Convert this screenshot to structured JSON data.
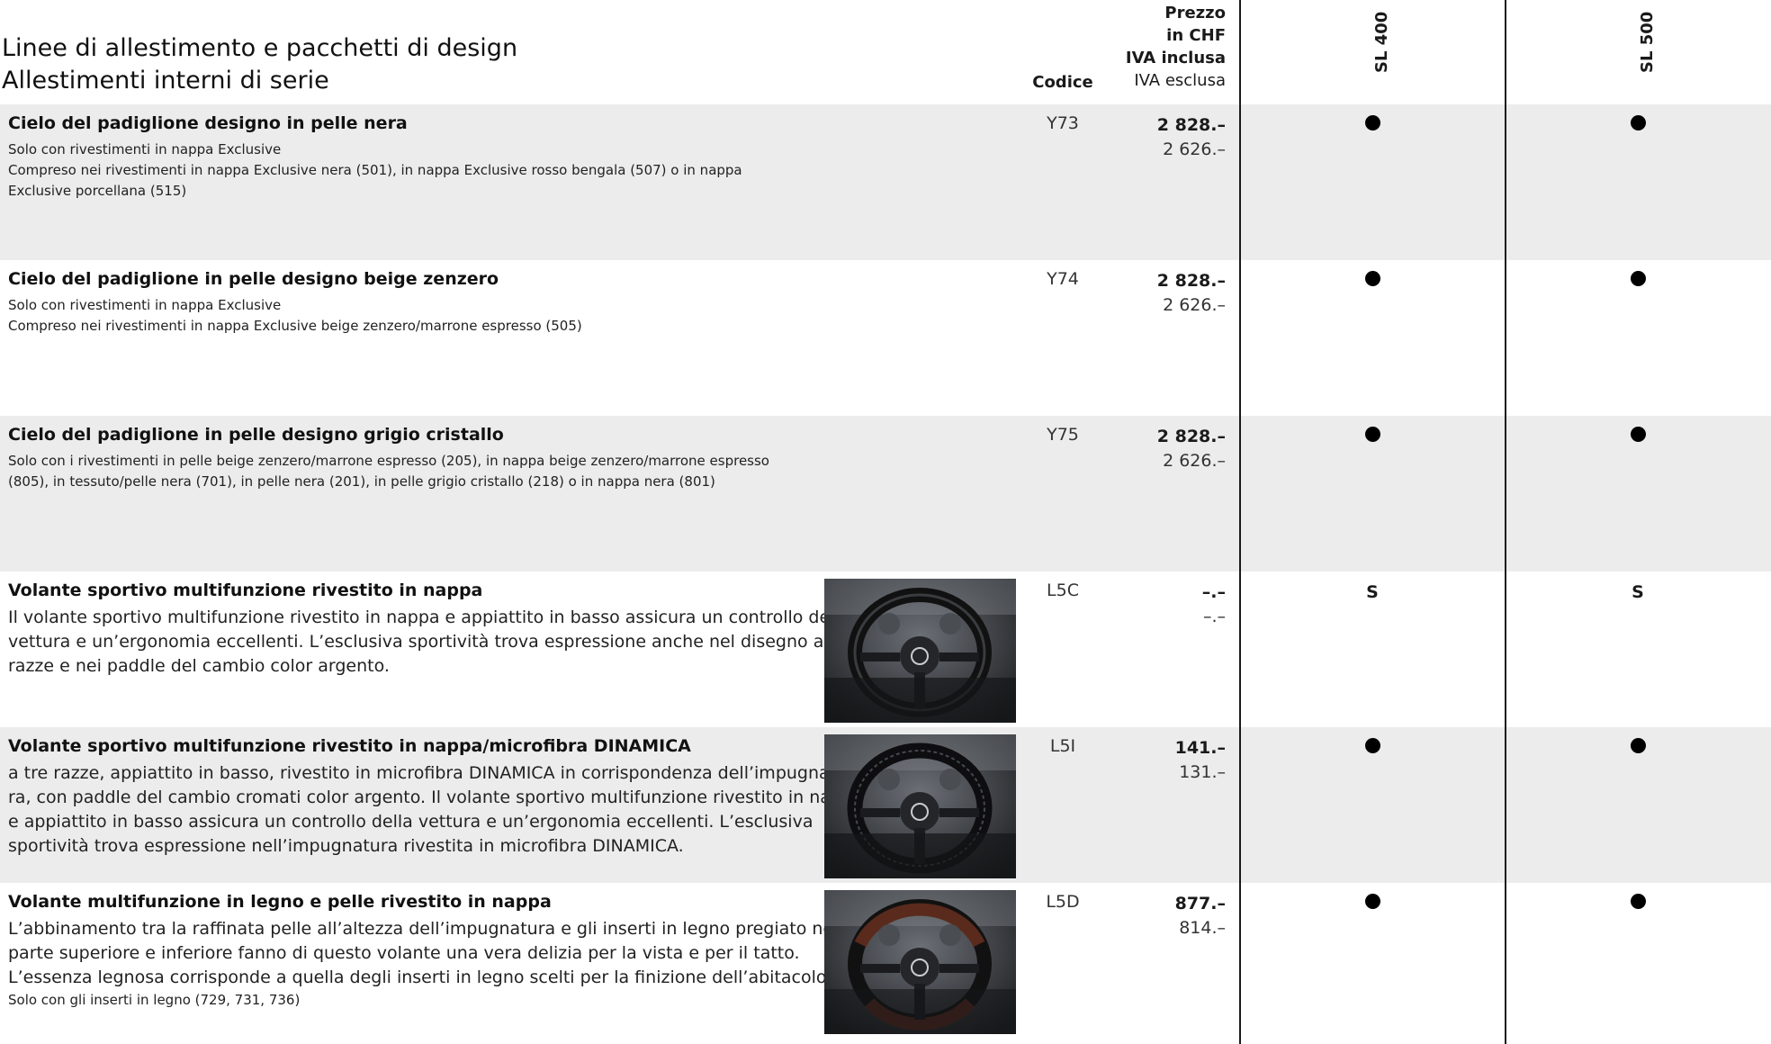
{
  "header": {
    "title_line1": "Linee di allestimento e pacchetti di design",
    "title_line2": "Allestimenti interni di serie",
    "code_label": "Codice",
    "price_line1": "Prezzo",
    "price_line2": "in CHF",
    "price_line3": "IVA inclusa",
    "price_line4": "IVA esclusa",
    "model1": "SL 400",
    "model2": "SL 500"
  },
  "rows": [
    {
      "title": "Cielo del padiglione designo in pelle nera",
      "notes": [
        "Solo con rivestimenti in nappa Exclusive",
        "Compreso nei rivestimenti in nappa Exclusive nera (501), in nappa Exclusive rosso bengala (507) o in nappa Exclusive porcellana (515)"
      ],
      "code": "Y73",
      "price_incl": "2 828.–",
      "price_excl": "2 626.–",
      "sl400": "●",
      "sl500": "●"
    },
    {
      "title": "Cielo del padiglione in pelle designo beige zenzero",
      "notes": [
        "Solo con rivestimenti in nappa Exclusive",
        "Compreso nei rivestimenti in nappa Exclusive beige zenzero/marrone espresso (505)"
      ],
      "code": "Y74",
      "price_incl": "2 828.–",
      "price_excl": "2 626.–",
      "sl400": "●",
      "sl500": "●"
    },
    {
      "title": "Cielo del padiglione in pelle designo grigio cristallo",
      "notes": [
        "Solo con i rivestimenti in pelle beige zenzero/marrone espresso (205), in nappa beige zenzero/marrone espresso (805), in tessuto/pelle nera (701), in pelle nera (201), in pelle grigio cristallo (218) o in nappa nera (801)"
      ],
      "code": "Y75",
      "price_incl": "2 828.–",
      "price_excl": "2 626.–",
      "sl400": "●",
      "sl500": "●"
    },
    {
      "title": "Volante sportivo multifunzione rivestito in nappa",
      "desc": [
        "Il volante sportivo multifunzione rivestito in nappa e appiattito in basso assicura un controllo della",
        "vettura e un’ergonomia eccellenti. L’esclusiva sportività trova espressione anche nel disegno a tre",
        "razze e nei paddle del cambio color argento."
      ],
      "code": "L5C",
      "price_incl": "–.–",
      "price_excl": "–.–",
      "sl400": "S",
      "sl500": "S"
    },
    {
      "title": "Volante sportivo multifunzione rivestito in nappa/microfibra DINAMICA",
      "desc": [
        "a tre razze, appiattito in basso, rivestito in microfibra DINAMICA in corrispondenza dell’impugnatu-",
        "ra, con paddle del cambio cromati color argento. Il volante sportivo multifunzione rivestito in nappa",
        "e appiattito in basso assicura un controllo della vettura e un’ergonomia eccellenti. L’esclusiva",
        "sportività trova espressione nell’impugnatura rivestita in microfibra DINAMICA."
      ],
      "code": "L5I",
      "price_incl": "141.–",
      "price_excl": "131.–",
      "sl400": "●",
      "sl500": "●"
    },
    {
      "title": "Volante multifunzione in legno e pelle rivestito in nappa",
      "desc": [
        "L’abbinamento tra la raffinata pelle all’altezza dell’impugnatura e gli inserti in legno pregiato nella",
        "parte superiore e inferiore fanno di questo volante una vera delizia per la vista e per il tatto.",
        "L’essenza legnosa corrisponde a quella degli inserti in legno scelti per la finizione dell’abitacolo."
      ],
      "note": "Solo con gli inserti in legno (729, 731, 736)",
      "code": "L5D",
      "price_incl": "877.–",
      "price_excl": "814.–",
      "sl400": "●",
      "sl500": "●"
    }
  ]
}
